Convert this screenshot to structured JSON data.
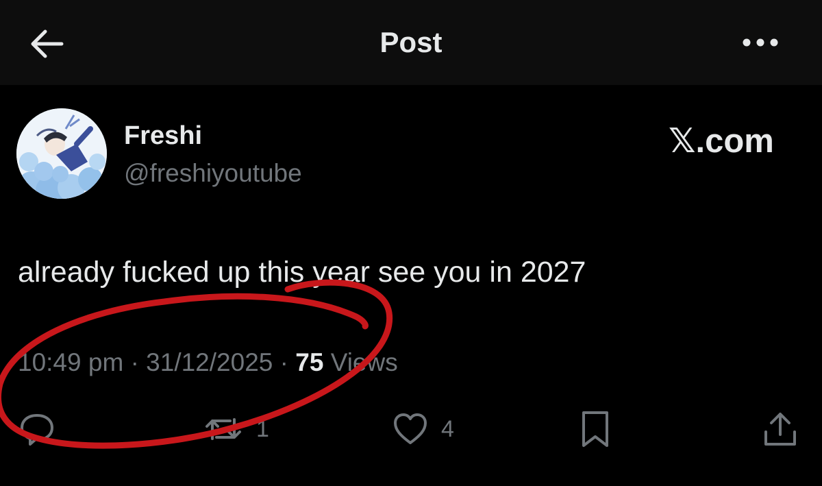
{
  "header": {
    "title": "Post",
    "back_icon": "arrow-left-icon",
    "more_icon": "more-horizontal-icon"
  },
  "author": {
    "display_name": "Freshi",
    "handle": "@freshiyoutube",
    "avatar_icon": "avatar-illustration"
  },
  "watermark": "𝕏.com",
  "post": {
    "text": "already fucked up this year see you in 2027"
  },
  "meta": {
    "time": "10:49 pm",
    "separator": "·",
    "date": "31/12/2025",
    "views_count": "75",
    "views_label": "Views"
  },
  "actions": {
    "reply": {
      "icon": "reply-icon",
      "count": ""
    },
    "repost": {
      "icon": "repost-icon",
      "count": "1"
    },
    "like": {
      "icon": "heart-icon",
      "count": "4"
    },
    "bookmark": {
      "icon": "bookmark-icon",
      "count": ""
    },
    "share": {
      "icon": "share-icon",
      "count": ""
    }
  },
  "colors": {
    "background": "#000000",
    "topbar": "#0d0d0d",
    "primary_text": "#e7e9ea",
    "secondary_text": "#71767b",
    "annotation_red": "#c8171b"
  }
}
